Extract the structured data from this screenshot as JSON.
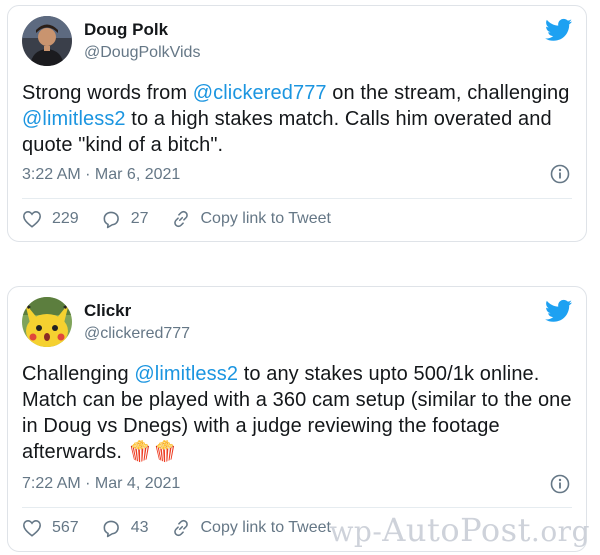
{
  "tweets": [
    {
      "name": "Doug Polk",
      "handle": "@DougPolkVids",
      "text_parts": [
        "Strong words from ",
        "@clickered777",
        " on the stream, challenging ",
        "@limitless2",
        " to a high stakes match. Calls him overated and quote \"kind of a bitch\"."
      ],
      "time": "3:22 AM · Mar 6, 2021",
      "likes": "229",
      "replies": "27",
      "copy_link": "Copy link to Tweet",
      "avatar_icon": "person-avatar-icon"
    },
    {
      "name": "Clickr",
      "handle": "@clickered777",
      "text_parts": [
        "Challenging ",
        "@limitless2",
        " to any stakes upto 500/1k online. Match can be played with a 360 cam setup (similar to the one in Doug vs Dnegs) with a judge reviewing the footage afterwards. ",
        "🍿🍿"
      ],
      "time": "7:22 AM · Mar 4, 2021",
      "likes": "567",
      "replies": "43",
      "copy_link": "Copy link to Tweet",
      "avatar_icon": "pikachu-avatar-icon"
    }
  ],
  "watermark": {
    "part1": "wp-",
    "part2": "AutoPost",
    "part3": ".org"
  },
  "colors": {
    "accent": "#1b95e0",
    "twitter_blue": "#1da1f2",
    "secondary_text": "#657786",
    "border": "#dfe3e8"
  }
}
